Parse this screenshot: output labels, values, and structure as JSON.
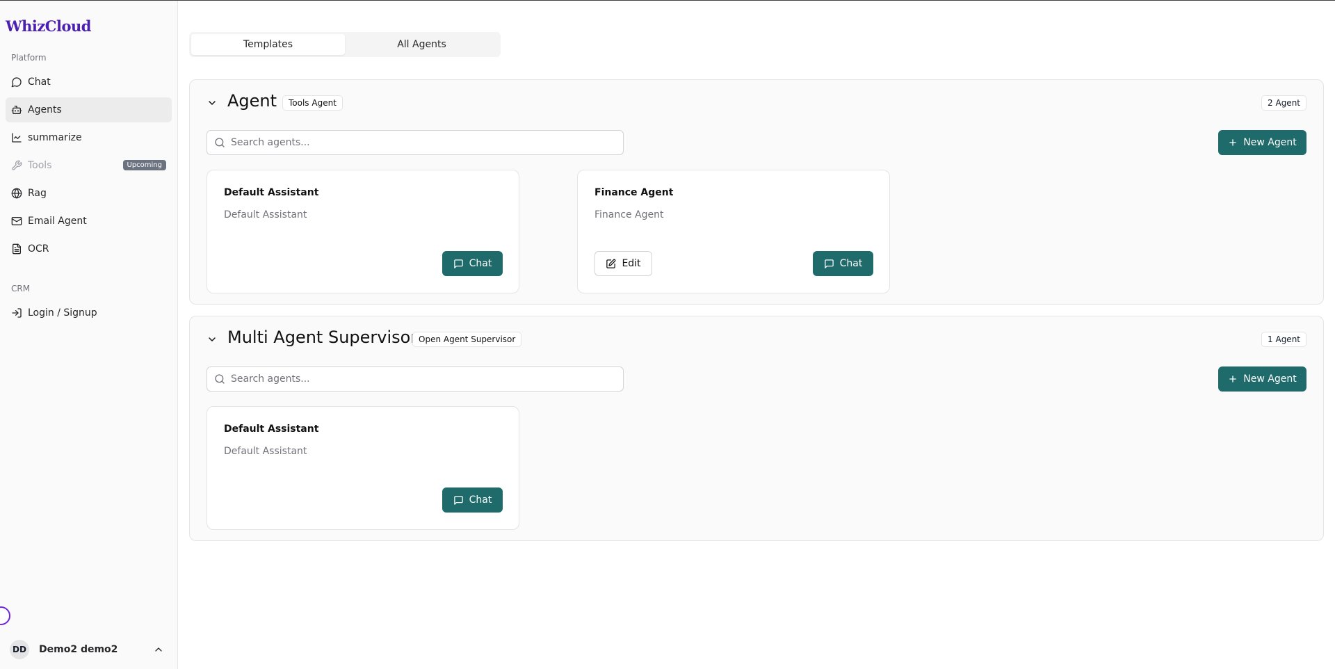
{
  "app": {
    "logo": "WhizCloud"
  },
  "sidebar": {
    "platform_label": "Platform",
    "items": [
      {
        "label": "Chat",
        "icon": "message-circle-icon"
      },
      {
        "label": "Agents",
        "icon": "bot-icon",
        "active": true
      },
      {
        "label": "summarize",
        "icon": "line-chart-icon"
      },
      {
        "label": "Tools",
        "icon": "wrench-icon",
        "disabled": true,
        "badge": "Upcoming"
      },
      {
        "label": "Rag",
        "icon": "globe-icon"
      },
      {
        "label": "Email Agent",
        "icon": "mail-icon"
      },
      {
        "label": "OCR",
        "icon": "file-text-icon"
      }
    ],
    "crm_label": "CRM",
    "crm_items": [
      {
        "label": "Login / Signup",
        "icon": "log-in-icon"
      }
    ],
    "user": {
      "initials": "DD",
      "name": "Demo2 demo2"
    }
  },
  "tabs": [
    {
      "label": "Templates",
      "active": true
    },
    {
      "label": "All Agents",
      "active": false
    }
  ],
  "sections": [
    {
      "title": "Agent",
      "tag": "Tools Agent",
      "count": "2 Agent",
      "search_placeholder": "Search agents...",
      "new_button": "New Agent",
      "cards": [
        {
          "title": "Default Assistant",
          "description": "Default Assistant",
          "chat": "Chat"
        },
        {
          "title": "Finance Agent",
          "description": "Finance Agent",
          "edit": "Edit",
          "chat": "Chat"
        }
      ]
    },
    {
      "title": "Multi Agent Supervisor",
      "tag": "Open Agent Supervisor",
      "count": "1 Agent",
      "search_placeholder": "Search agents...",
      "new_button": "New Agent",
      "cards": [
        {
          "title": "Default Assistant",
          "description": "Default Assistant",
          "chat": "Chat"
        }
      ]
    }
  ],
  "colors": {
    "accent": "#1f6b6b",
    "brand": "#4b1fb0"
  }
}
